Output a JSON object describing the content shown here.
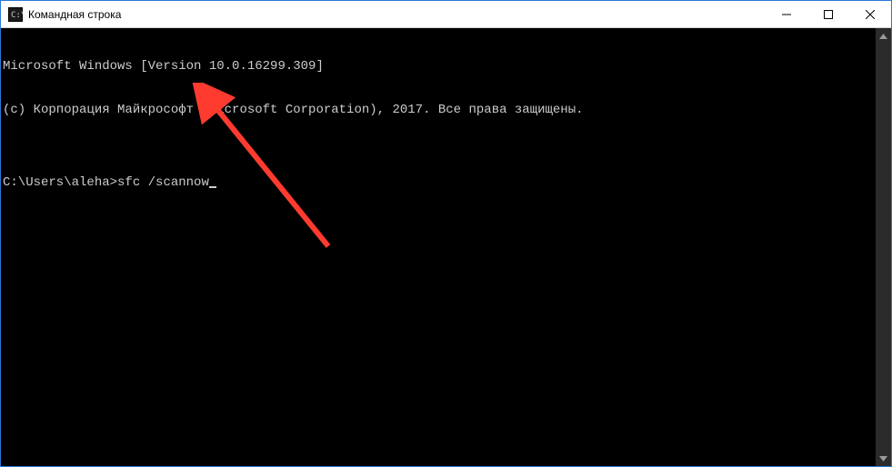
{
  "window": {
    "title": "Командная строка"
  },
  "terminal": {
    "line1": "Microsoft Windows [Version 10.0.16299.309]",
    "line2": "(c) Корпорация Майкрософт (Microsoft Corporation), 2017. Все права защищены.",
    "blank": "",
    "prompt": "C:\\Users\\aleha>",
    "command": "sfc /scannow"
  },
  "annotation": {
    "color": "#ff3b30"
  }
}
